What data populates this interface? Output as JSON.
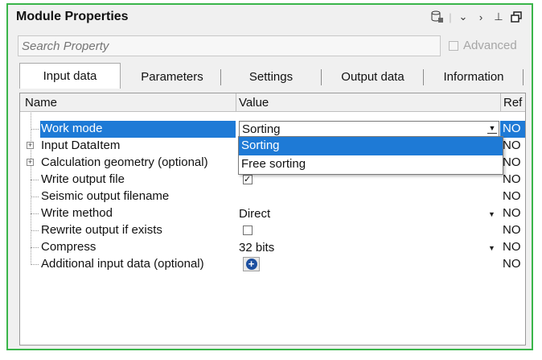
{
  "panel": {
    "title": "Module Properties",
    "accent": "#3ab54a"
  },
  "title_icons": [
    "database-icon",
    "chevron-down-icon",
    "chevron-right-icon",
    "pin-icon",
    "restore-window-icon"
  ],
  "search": {
    "placeholder": "Search Property"
  },
  "advanced": {
    "label": "Advanced",
    "checked": false
  },
  "tabs": [
    {
      "label": "Input data",
      "active": true
    },
    {
      "label": "Parameters",
      "active": false
    },
    {
      "label": "Settings",
      "active": false
    },
    {
      "label": "Output data",
      "active": false
    },
    {
      "label": "Information",
      "active": false
    }
  ],
  "columns": {
    "name": "Name",
    "value": "Value",
    "ref": "Ref"
  },
  "rows": [
    {
      "name": "Work mode",
      "value": "Sorting",
      "ref": "NO",
      "selected": true
    },
    {
      "name": "Input DataItem",
      "value": "",
      "ref": "NO"
    },
    {
      "name": "Calculation geometry (optional)",
      "value": "",
      "ref": "NO"
    },
    {
      "name": "Write output file",
      "value": "✓",
      "ref": "NO"
    },
    {
      "name": "Seismic output filename",
      "value": "",
      "ref": "NO"
    },
    {
      "name": "Write method",
      "value": "Direct",
      "ref": "NO"
    },
    {
      "name": "Rewrite output if exists",
      "value": "",
      "ref": "NO"
    },
    {
      "name": "Compress",
      "value": "32 bits",
      "ref": "NO"
    },
    {
      "name": "Additional input data (optional)",
      "value": "+",
      "ref": "NO"
    }
  ],
  "dropdown": {
    "options": [
      "Sorting",
      "Free sorting"
    ],
    "selected": "Sorting"
  },
  "colors": {
    "selection": "#1e7ad6",
    "add_button": "#1c4fa0"
  }
}
